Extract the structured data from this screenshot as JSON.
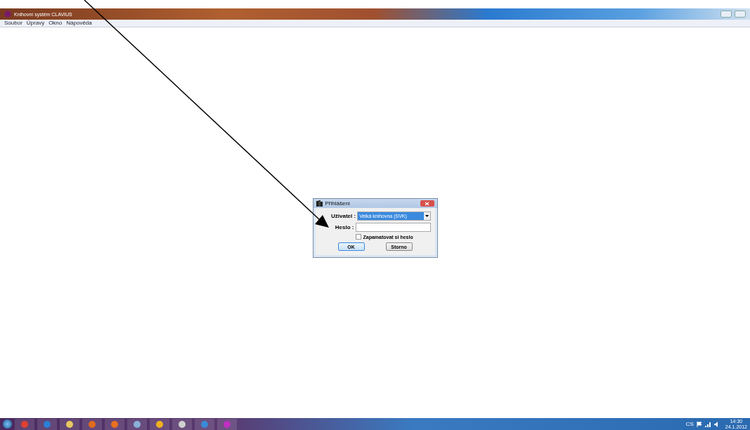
{
  "window": {
    "title": "Knihovní systém CLAVIUS"
  },
  "menu": [
    "Soubor",
    "Úpravy",
    "Okno",
    "Nápověda"
  ],
  "dialog": {
    "title": "Přihlášení",
    "user_label": "Uživatel :",
    "user_value": "Velká knihovna (SVK)",
    "password_label": "Heslo :",
    "remember": {
      "label": "Zapamatovat si heslo",
      "checked": false
    },
    "buttons": [
      {
        "label": "OK",
        "selected": true
      },
      {
        "label": "Storno",
        "selected": false
      }
    ]
  },
  "taskbar": {
    "apps": [
      {
        "color": "#e04030"
      },
      {
        "color": "#2a7fd4"
      },
      {
        "color": "#e8c860"
      },
      {
        "color": "#e06a20"
      },
      {
        "color": "#e87020"
      },
      {
        "color": "#8ab0d8"
      },
      {
        "color": "#f0b020"
      },
      {
        "color": "#d0d0d0"
      },
      {
        "color": "#3a8ad8"
      },
      {
        "color": "#c030c0"
      }
    ],
    "language": "CS",
    "time": "14:30",
    "date": "24.1.2012"
  }
}
